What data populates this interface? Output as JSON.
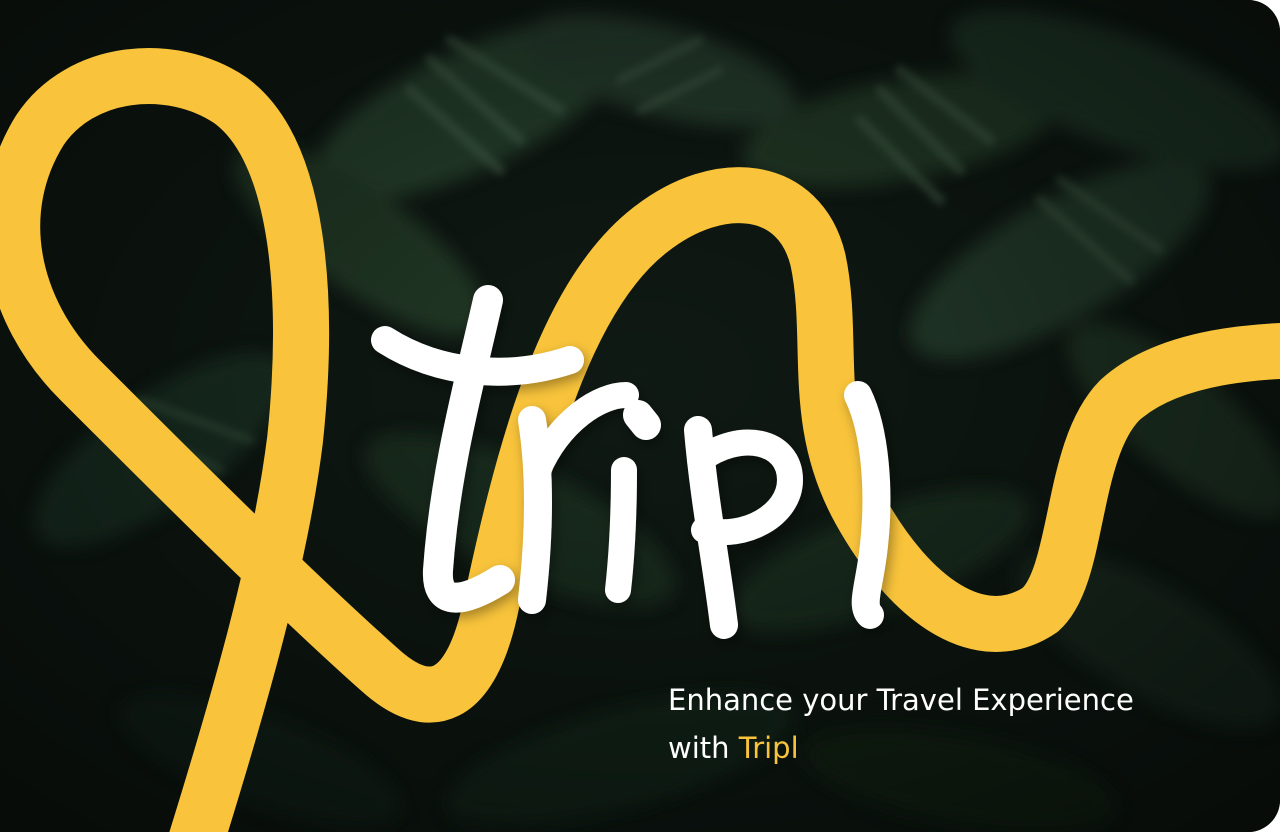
{
  "brand": {
    "name": "Tripl",
    "accent_color": "#f9c43b",
    "background_color": "#0f1712"
  },
  "hero": {
    "logo_text": "tripl",
    "tagline_prefix": "Enhance your Travel Experience",
    "tagline_with": "with",
    "tagline_brand": "Tripl"
  }
}
